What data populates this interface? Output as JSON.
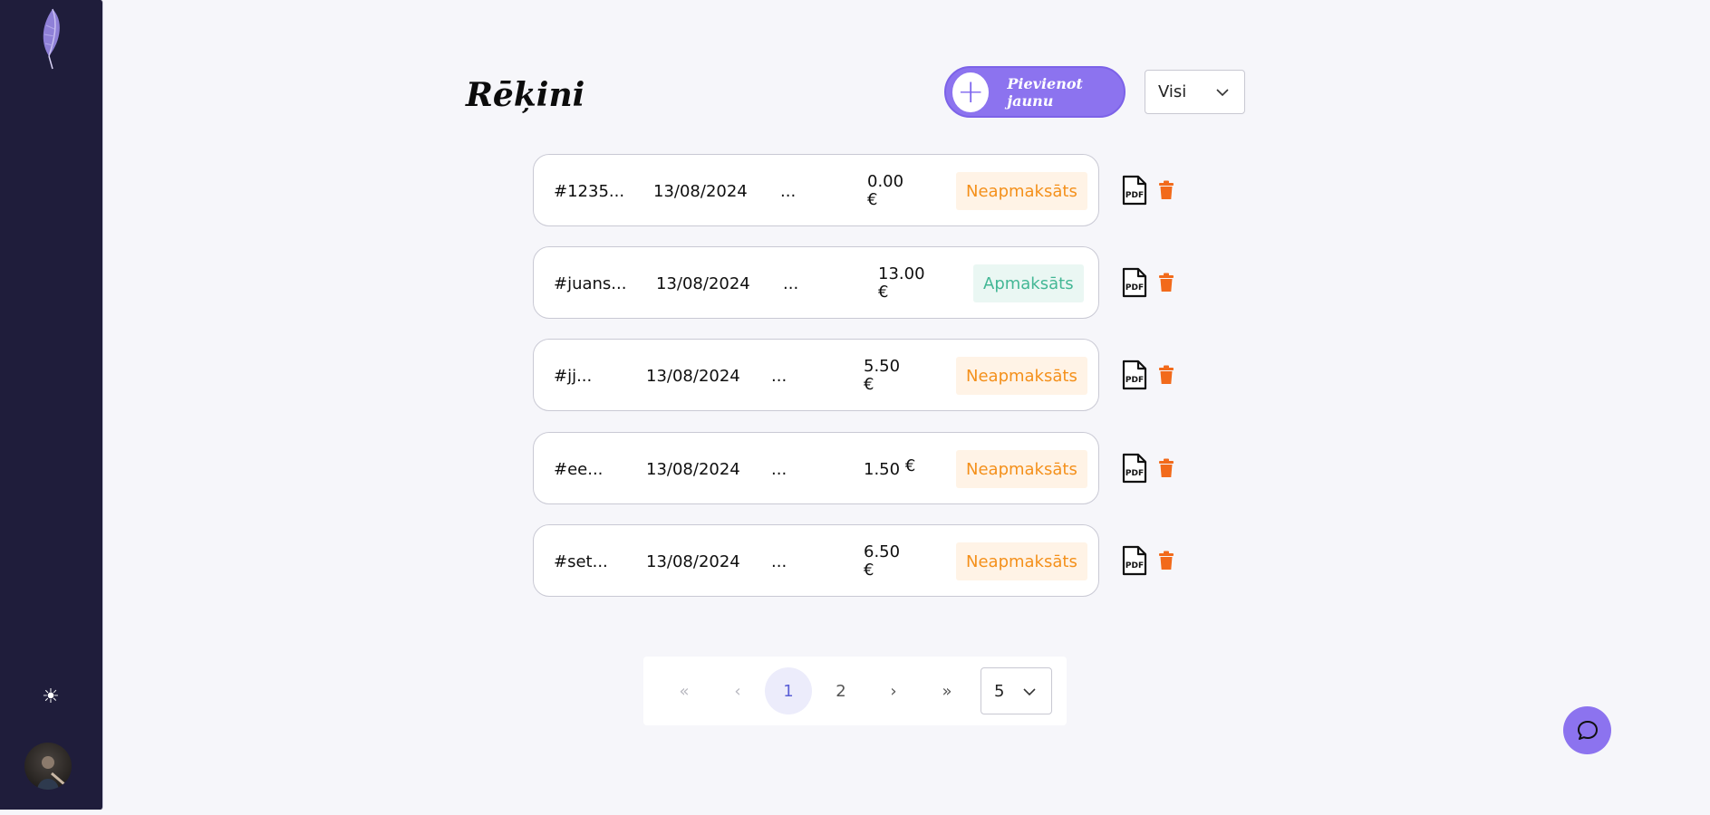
{
  "header": {
    "title": "Rēķini",
    "add_button_label": "Pievienot jaunu",
    "filter_value": "Visi"
  },
  "invoices": [
    {
      "id": "#1235...",
      "date": "13/08/2024",
      "client": "...",
      "amount": "0.00",
      "currency": "€",
      "status": "Neapmaksāts",
      "paid": false
    },
    {
      "id": "#juans...",
      "date": "13/08/2024",
      "client": "...",
      "amount": "13.00",
      "currency": "€",
      "status": "Apmaksāts",
      "paid": true
    },
    {
      "id": "#jj...",
      "date": "13/08/2024",
      "client": "...",
      "amount": "5.50",
      "currency": "€",
      "status": "Neapmaksāts",
      "paid": false
    },
    {
      "id": "#ee...",
      "date": "13/08/2024",
      "client": "...",
      "amount": "1.50",
      "currency": "€",
      "status": "Neapmaksāts",
      "paid": false
    },
    {
      "id": "#set...",
      "date": "13/08/2024",
      "client": "...",
      "amount": "6.50",
      "currency": "€",
      "status": "Neapmaksāts",
      "paid": false
    }
  ],
  "pagination": {
    "first": "«",
    "prev": "‹",
    "pages": [
      "1",
      "2"
    ],
    "current": "1",
    "next": "›",
    "last": "»",
    "page_size": "5"
  },
  "icons": {
    "sidebar_logo": "feather-logo",
    "theme_toggle": "sun-icon",
    "user": "avatar",
    "row_actions": [
      "pdf-icon",
      "trash-icon"
    ],
    "chat": "chat-bubble-icon"
  },
  "colors": {
    "sidebar": "#1f1d3b",
    "accent": "#8c73ef",
    "unpaid": "#f4901b",
    "paid": "#43b795",
    "delete": "#f26a1b"
  }
}
